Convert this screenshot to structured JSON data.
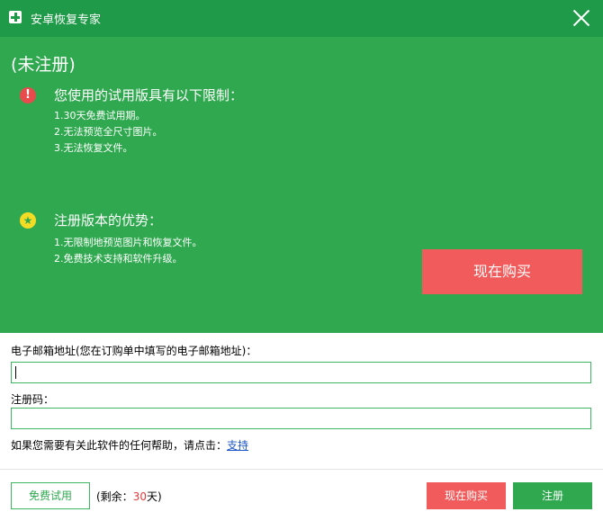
{
  "window": {
    "title": "安卓恢复专家",
    "app_icon": "plus-cross-icon",
    "close_icon": "close-icon"
  },
  "panel": {
    "status": "(未注册)",
    "trial_heading": "您使用的试用版具有以下限制：",
    "trial_limits": [
      "1.30天免费试用期。",
      "2.无法预览全尺寸图片。",
      "3.无法恢复文件。"
    ],
    "benefits_heading": "注册版本的优势：",
    "benefits": [
      "1.无限制地预览图片和恢复文件。",
      "2.免费技术支持和软件升级。"
    ],
    "buy_now_label": "现在购买"
  },
  "form": {
    "email_label": "电子邮箱地址(您在订购单中填写的电子邮箱地址)：",
    "email_value": "",
    "code_label": "注册码：",
    "code_value": "",
    "help_text": "如果您需要有关此软件的任何帮助，请点击：",
    "help_link": "支持"
  },
  "footer": {
    "trial_button": "免费试用",
    "remaining_prefix": "(剩余：",
    "remaining_days": "30",
    "remaining_suffix": "天)",
    "buy_button": "现在购买",
    "register_button": "注册"
  },
  "colors": {
    "green_dark": "#1f9a48",
    "green": "#2fa84f",
    "red": "#f25b5b",
    "star_yellow": "#f4dc25",
    "link_blue": "#1d56c6"
  }
}
